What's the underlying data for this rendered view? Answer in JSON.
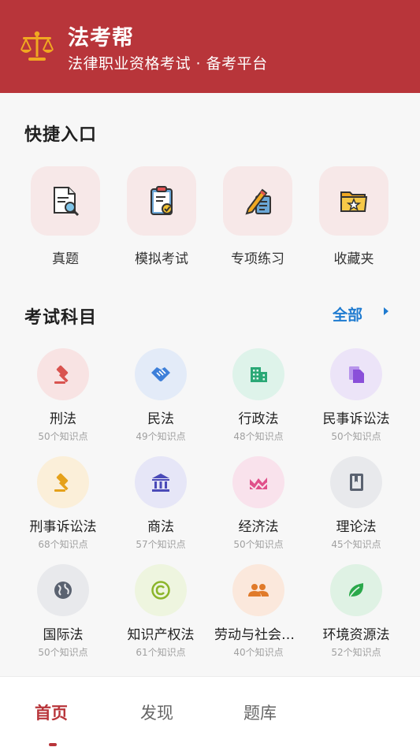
{
  "header": {
    "title": "法考帮",
    "subtitle": "法律职业资格考试 · 备考平台",
    "bg_color": "#b8353a",
    "logo_icon": "scales-icon"
  },
  "quick_access": {
    "title": "快捷入口",
    "items": [
      {
        "label": "真题",
        "icon": "document-search-icon"
      },
      {
        "label": "模拟考试",
        "icon": "clipboard-check-icon"
      },
      {
        "label": "专项练习",
        "icon": "pencil-notes-icon"
      },
      {
        "label": "收藏夹",
        "icon": "star-folder-icon"
      }
    ]
  },
  "subjects": {
    "title": "考试科目",
    "see_all": "全部",
    "items": [
      {
        "name": "刑法",
        "count": "50个知识点",
        "icon": "gavel-icon",
        "color": "#d9534f",
        "bg": "#f8e3e3"
      },
      {
        "name": "民法",
        "count": "49个知识点",
        "icon": "handshake-icon",
        "color": "#3d7fd9",
        "bg": "#e3ebf8"
      },
      {
        "name": "行政法",
        "count": "48个知识点",
        "icon": "building-icon",
        "color": "#2aa876",
        "bg": "#def3ea"
      },
      {
        "name": "民事诉讼法",
        "count": "50个知识点",
        "icon": "documents-icon",
        "color": "#8a4fd9",
        "bg": "#ece4f8"
      },
      {
        "name": "刑事诉讼法",
        "count": "68个知识点",
        "icon": "gavel-icon",
        "color": "#e5a11a",
        "bg": "#fbefd9"
      },
      {
        "name": "商法",
        "count": "57个知识点",
        "icon": "bank-icon",
        "color": "#4a4ab8",
        "bg": "#e6e6f7"
      },
      {
        "name": "经济法",
        "count": "50个知识点",
        "icon": "chart-icon",
        "color": "#e0508a",
        "bg": "#f9e2ec"
      },
      {
        "name": "理论法",
        "count": "45个知识点",
        "icon": "book-icon",
        "color": "#5a6270",
        "bg": "#e8e9ec"
      },
      {
        "name": "国际法",
        "count": "50个知识点",
        "icon": "globe-icon",
        "color": "#5a6270",
        "bg": "#e8e9ec"
      },
      {
        "name": "知识产权法",
        "count": "61个知识点",
        "icon": "copyright-icon",
        "color": "#8bb52a",
        "bg": "#eef5df"
      },
      {
        "name": "劳动与社会保障法",
        "count": "40个知识点",
        "icon": "people-icon",
        "color": "#e07a2a",
        "bg": "#fbe8dc"
      },
      {
        "name": "环境资源法",
        "count": "52个知识点",
        "icon": "leaf-icon",
        "color": "#2aa84a",
        "bg": "#dff2e4"
      }
    ]
  },
  "bottom_nav": {
    "items": [
      {
        "label": "首页",
        "active": true
      },
      {
        "label": "发现"
      },
      {
        "label": "题库"
      }
    ]
  }
}
